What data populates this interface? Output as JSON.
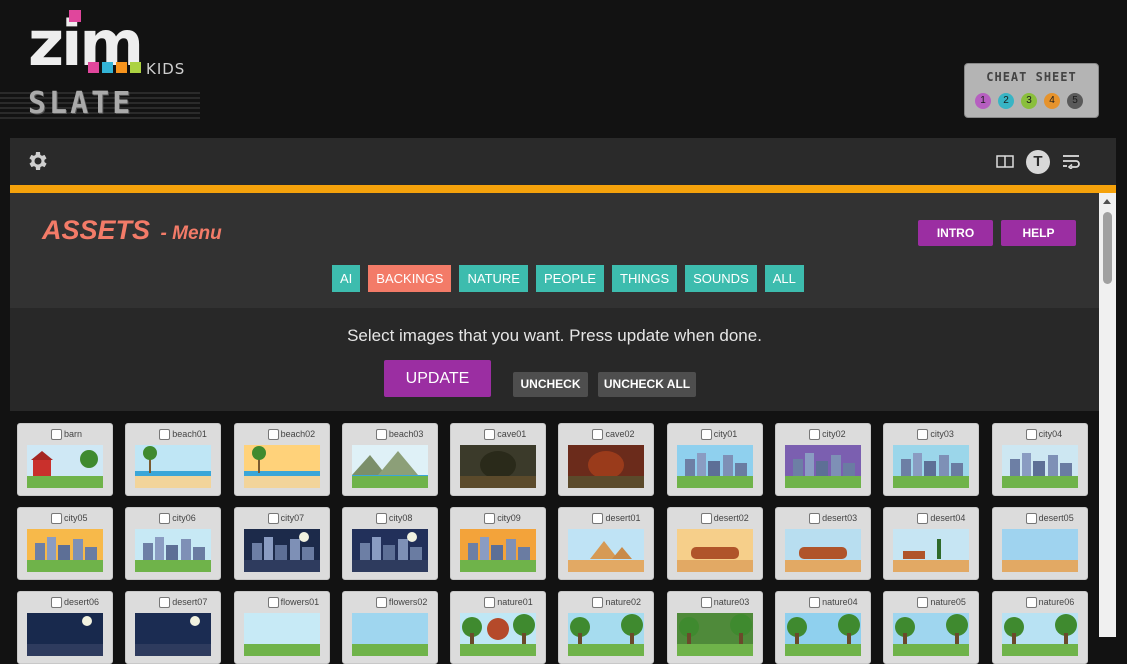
{
  "logo": {
    "brand": "zim",
    "kids": "KIDS",
    "product": "SLATE",
    "square_colors": [
      "#e0469c",
      "#33b4d6",
      "#f7941d",
      "#acd241"
    ]
  },
  "cheat_sheet": {
    "title": "CHEAT SHEET",
    "items": [
      {
        "label": "1",
        "color": "#b65fc0"
      },
      {
        "label": "2",
        "color": "#38b4c4"
      },
      {
        "label": "3",
        "color": "#8abf3c"
      },
      {
        "label": "4",
        "color": "#e6932c"
      },
      {
        "label": "5",
        "color": "#5a5a5a"
      }
    ]
  },
  "toolbar": {
    "settings_icon": "gear-icon",
    "right_icons": [
      "split-view-icon",
      "text-t-icon",
      "wrap-icon"
    ],
    "text_icon_label": "T"
  },
  "colors": {
    "accent_orange": "#f5a20b",
    "accent_purple": "#9b2ea2",
    "teal": "#3dbcae",
    "coral": "#f37b68"
  },
  "assets": {
    "title": "ASSETS",
    "subtitle": "- Menu",
    "intro_label": "INTRO",
    "help_label": "HELP",
    "categories": [
      {
        "label": "AI",
        "active": false
      },
      {
        "label": "BACKINGS",
        "active": true
      },
      {
        "label": "NATURE",
        "active": false
      },
      {
        "label": "PEOPLE",
        "active": false
      },
      {
        "label": "THINGS",
        "active": false
      },
      {
        "label": "SOUNDS",
        "active": false
      },
      {
        "label": "ALL",
        "active": false
      }
    ]
  },
  "selection": {
    "instruction": "Select images that you want. Press update when done.",
    "update_label": "UPDATE",
    "uncheck_label": "UNCHECK",
    "uncheck_all_label": "UNCHECK ALL"
  },
  "items": [
    {
      "name": "barn",
      "scene": "barn"
    },
    {
      "name": "beach01",
      "scene": "beach"
    },
    {
      "name": "beach02",
      "scene": "beach2"
    },
    {
      "name": "beach03",
      "scene": "mountains"
    },
    {
      "name": "cave01",
      "scene": "cave"
    },
    {
      "name": "cave02",
      "scene": "cave2"
    },
    {
      "name": "city01",
      "scene": "city"
    },
    {
      "name": "city02",
      "scene": "citypurple"
    },
    {
      "name": "city03",
      "scene": "cityriver"
    },
    {
      "name": "city04",
      "scene": "citystreet"
    },
    {
      "name": "city05",
      "scene": "citysunset"
    },
    {
      "name": "city06",
      "scene": "citypark"
    },
    {
      "name": "city07",
      "scene": "citynight"
    },
    {
      "name": "city08",
      "scene": "citynight2"
    },
    {
      "name": "city09",
      "scene": "citysunset2"
    },
    {
      "name": "desert01",
      "scene": "pyramids"
    },
    {
      "name": "desert02",
      "scene": "desertrock"
    },
    {
      "name": "desert03",
      "scene": "desertrock2"
    },
    {
      "name": "desert04",
      "scene": "desertcactus"
    },
    {
      "name": "desert05",
      "scene": "desertsky"
    },
    {
      "name": "desert06",
      "scene": "desertnight"
    },
    {
      "name": "desert07",
      "scene": "desertnight2"
    },
    {
      "name": "flowers01",
      "scene": "flowers"
    },
    {
      "name": "flowers02",
      "scene": "flowers2"
    },
    {
      "name": "nature01",
      "scene": "tree"
    },
    {
      "name": "nature02",
      "scene": "forest"
    },
    {
      "name": "nature03",
      "scene": "forest2"
    },
    {
      "name": "nature04",
      "scene": "forest3"
    },
    {
      "name": "nature05",
      "scene": "forest4"
    },
    {
      "name": "nature06",
      "scene": "forest5"
    }
  ]
}
